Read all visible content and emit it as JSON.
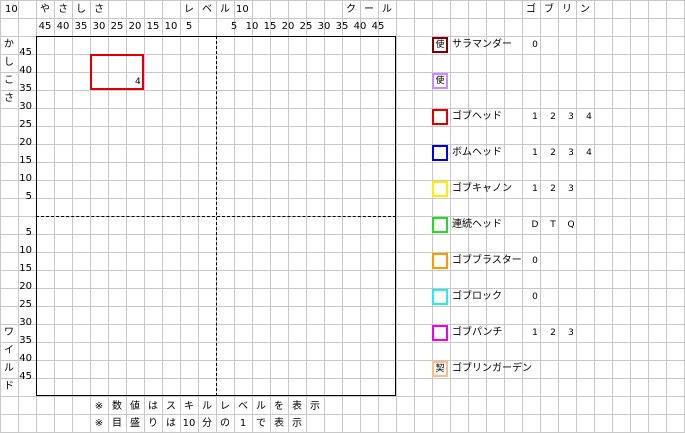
{
  "header": {
    "left_number": "10",
    "left_title": [
      "や",
      "さ",
      "し",
      "さ"
    ],
    "mid_title": [
      "レ",
      "ベ",
      "ル"
    ],
    "mid_number": "10",
    "right_title": [
      "ク",
      "ー",
      "ル"
    ],
    "goblin_title": [
      "ゴ",
      "ブ",
      "リ",
      "ン"
    ]
  },
  "axis": {
    "top_left_ticks": [
      "45",
      "40",
      "35",
      "30",
      "25",
      "20",
      "15",
      "10",
      "5"
    ],
    "top_right_ticks": [
      "5",
      "10",
      "15",
      "20",
      "25",
      "30",
      "35",
      "40",
      "45"
    ],
    "left_upper_ticks": [
      "45",
      "40",
      "35",
      "30",
      "25",
      "20",
      "15",
      "10",
      "5"
    ],
    "left_lower_ticks": [
      "5",
      "10",
      "15",
      "20",
      "25",
      "30",
      "35",
      "40",
      "45"
    ],
    "upper_label": [
      "か",
      "し",
      "こ",
      "さ"
    ],
    "lower_label": [
      "ワ",
      "イ",
      "ル",
      "ド"
    ]
  },
  "chart_data": {
    "type": "scatter",
    "title": "",
    "xlabel_left": "やさしさ",
    "xlabel_right": "クール",
    "ylabel_top": "かしこさ",
    "ylabel_bottom": "ワイルド",
    "xlim": [
      -50,
      50
    ],
    "ylim": [
      -50,
      50
    ],
    "regions": [
      {
        "name": "ゴブヘッド",
        "x": [
          -35,
          -20
        ],
        "y": [
          35,
          45
        ],
        "level_label": "4",
        "color": "#e00000"
      }
    ]
  },
  "legend": [
    {
      "name": "サラマンダー",
      "icon_text": "使",
      "color": "#800000",
      "levels": [
        "0"
      ]
    },
    {
      "name": "",
      "icon_text": "使",
      "color": "#cc88ff",
      "levels": []
    },
    {
      "name": "ゴブヘッド",
      "icon_text": "",
      "color": "#e00000",
      "levels": [
        "1",
        "2",
        "3",
        "4"
      ]
    },
    {
      "name": "ボムヘッド",
      "icon_text": "",
      "color": "#0000e0",
      "levels": [
        "1",
        "2",
        "3",
        "4"
      ]
    },
    {
      "name": "ゴブキャノン",
      "icon_text": "",
      "color": "#ffee00",
      "levels": [
        "1",
        "2",
        "3"
      ]
    },
    {
      "name": "連続ヘッド",
      "icon_text": "",
      "color": "#22dd22",
      "levels": [
        "D",
        "T",
        "Q"
      ]
    },
    {
      "name": "ゴブブラスター",
      "icon_text": "",
      "color": "#ff9900",
      "levels": [
        "0"
      ]
    },
    {
      "name": "ゴブロック",
      "icon_text": "",
      "color": "#22eeee",
      "levels": [
        "0"
      ]
    },
    {
      "name": "ゴブパンチ",
      "icon_text": "",
      "color": "#ee00ee",
      "levels": [
        "1",
        "2",
        "3"
      ]
    },
    {
      "name": "ゴブリンガーデン",
      "icon_text": "契",
      "color": "#ffbb88",
      "levels": []
    }
  ],
  "notes": [
    [
      "※",
      "数",
      "値",
      "は",
      "ス",
      "キ",
      "ル",
      "レ",
      "ベ",
      "ル",
      "を",
      "表",
      "示"
    ],
    [
      "※",
      "目",
      "盛",
      "り",
      "は",
      "10",
      "分",
      "の",
      "1",
      "で",
      "表",
      "示"
    ]
  ]
}
